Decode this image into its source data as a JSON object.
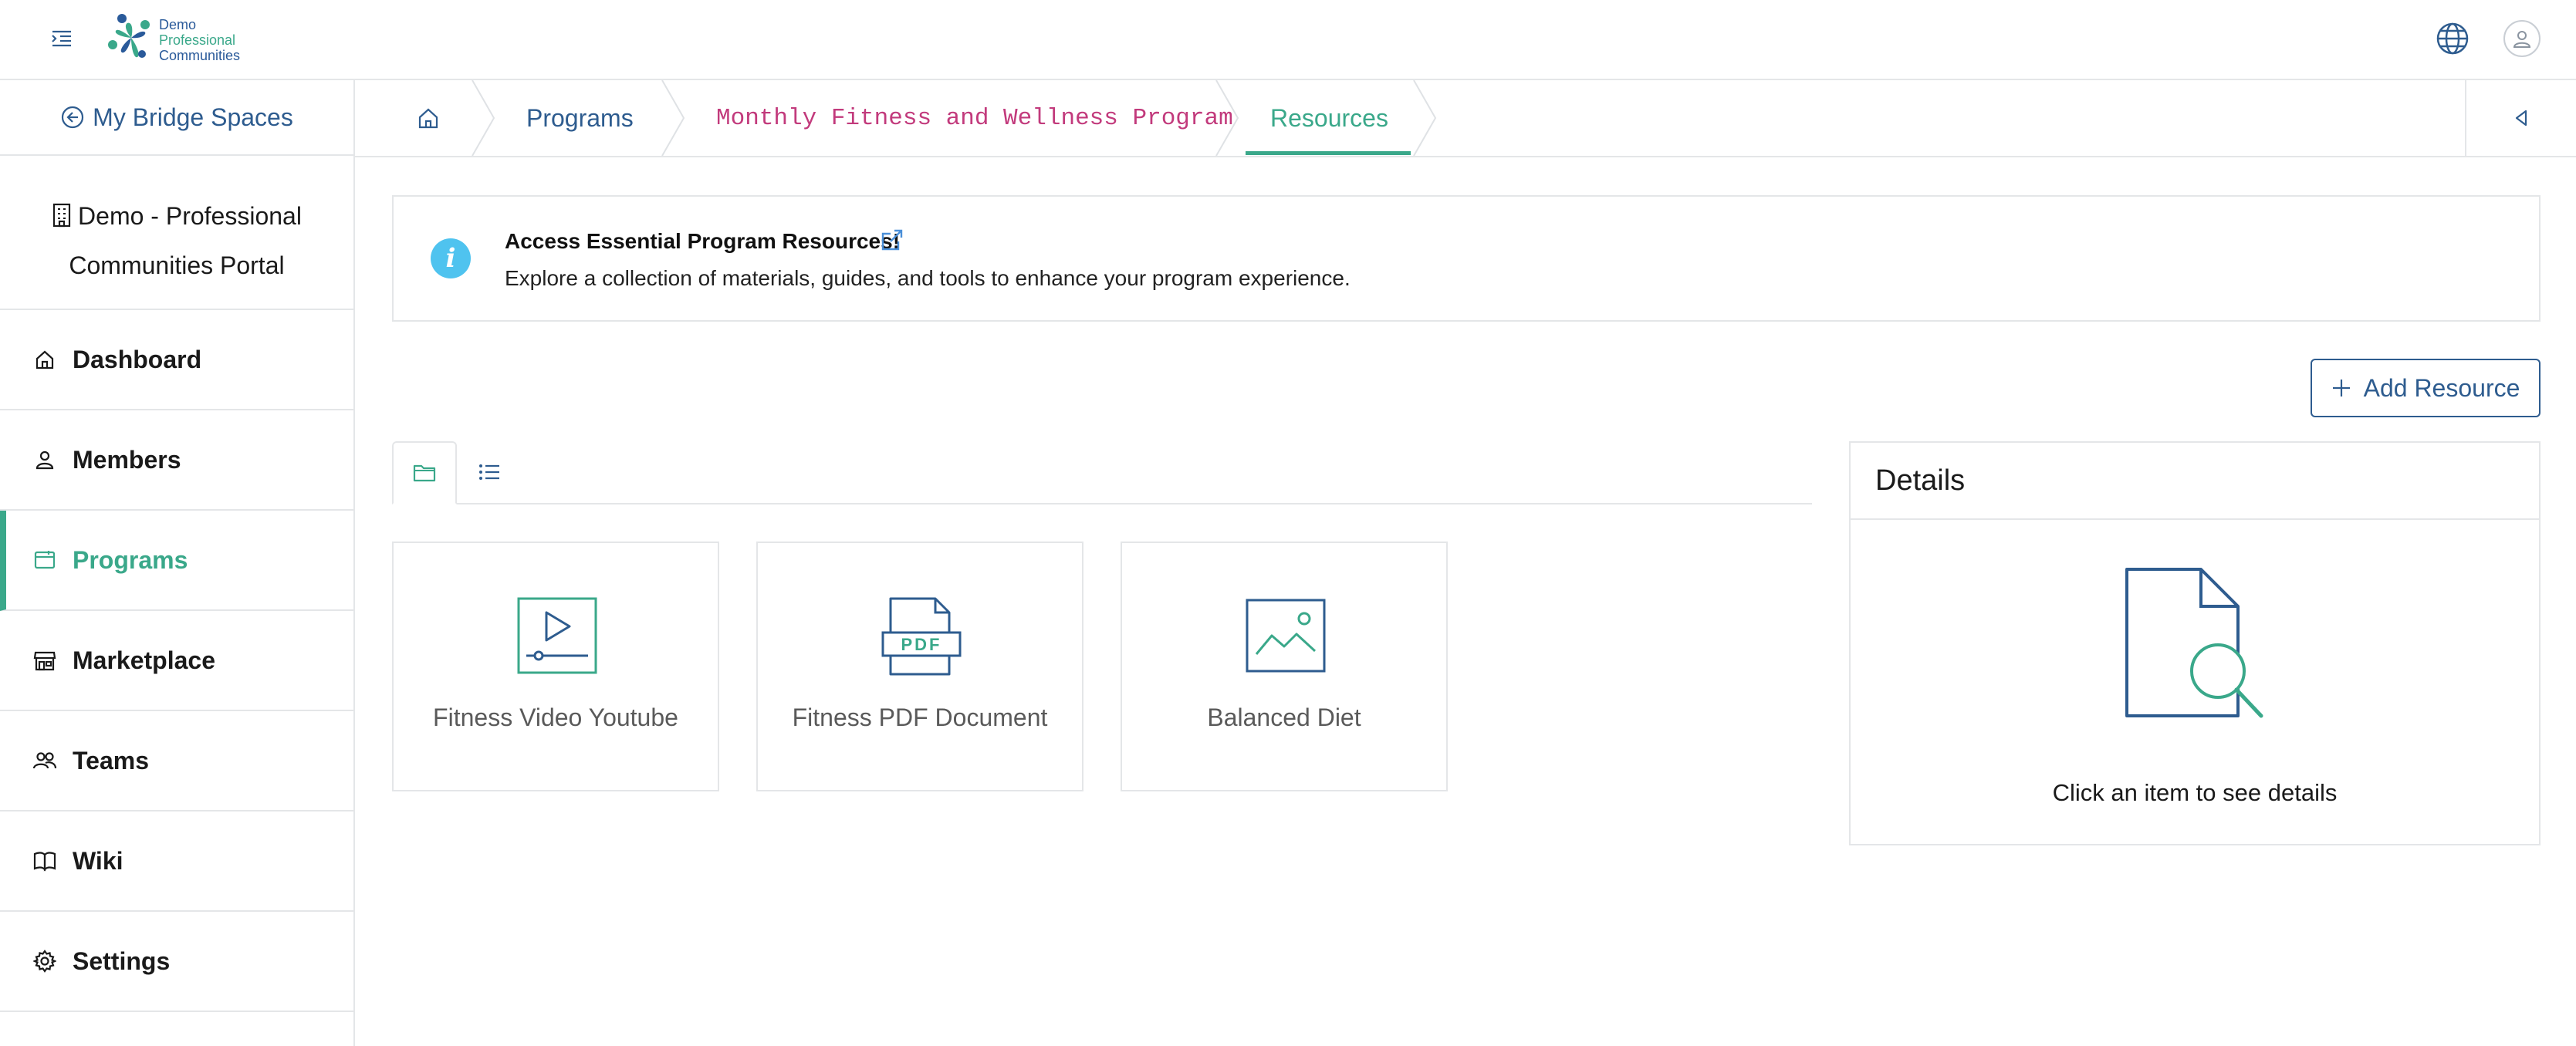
{
  "header": {
    "logo_lines": [
      "Demo",
      "Professional",
      "Communities"
    ],
    "menu_toggle_icon": "menu-indent-icon",
    "language_icon": "globe-icon",
    "user_icon": "user-avatar-icon"
  },
  "sidebar": {
    "back_label": "My Bridge Spaces",
    "org_name_line1": "Demo - Professional",
    "org_name_line2": "Communities Portal",
    "items": [
      {
        "label": "Dashboard",
        "icon": "home-icon"
      },
      {
        "label": "Members",
        "icon": "person-icon"
      },
      {
        "label": "Programs",
        "icon": "calendar-icon",
        "active": true
      },
      {
        "label": "Marketplace",
        "icon": "store-icon"
      },
      {
        "label": "Teams",
        "icon": "people-icon"
      },
      {
        "label": "Wiki",
        "icon": "book-icon"
      },
      {
        "label": "Settings",
        "icon": "gear-icon"
      }
    ]
  },
  "breadcrumb": {
    "home_icon": "home-icon",
    "items": [
      "Programs",
      "Monthly Fitness and Wellness Program",
      "Resources"
    ],
    "active": "Resources"
  },
  "info_banner": {
    "title": "Access Essential Program Resources!",
    "text": "Explore a collection of materials, guides, and tools to enhance your program experience."
  },
  "actions": {
    "add_resource_label": "Add Resource"
  },
  "view_tabs": [
    "folder-view",
    "list-view"
  ],
  "resources": [
    {
      "label": "Fitness Video Youtube",
      "icon": "video-icon"
    },
    {
      "label": "Fitness PDF Document",
      "icon": "pdf-icon",
      "icon_text": "PDF"
    },
    {
      "label": "Balanced Diet",
      "icon": "image-icon"
    }
  ],
  "details": {
    "title": "Details",
    "empty_text": "Click an item to see details"
  },
  "colors": {
    "primary": "#2e5c8f",
    "accent": "#3aa88a",
    "breadcrumb_program": "#c23a7c",
    "info": "#4fc3ef",
    "border": "#e4e6e8"
  }
}
